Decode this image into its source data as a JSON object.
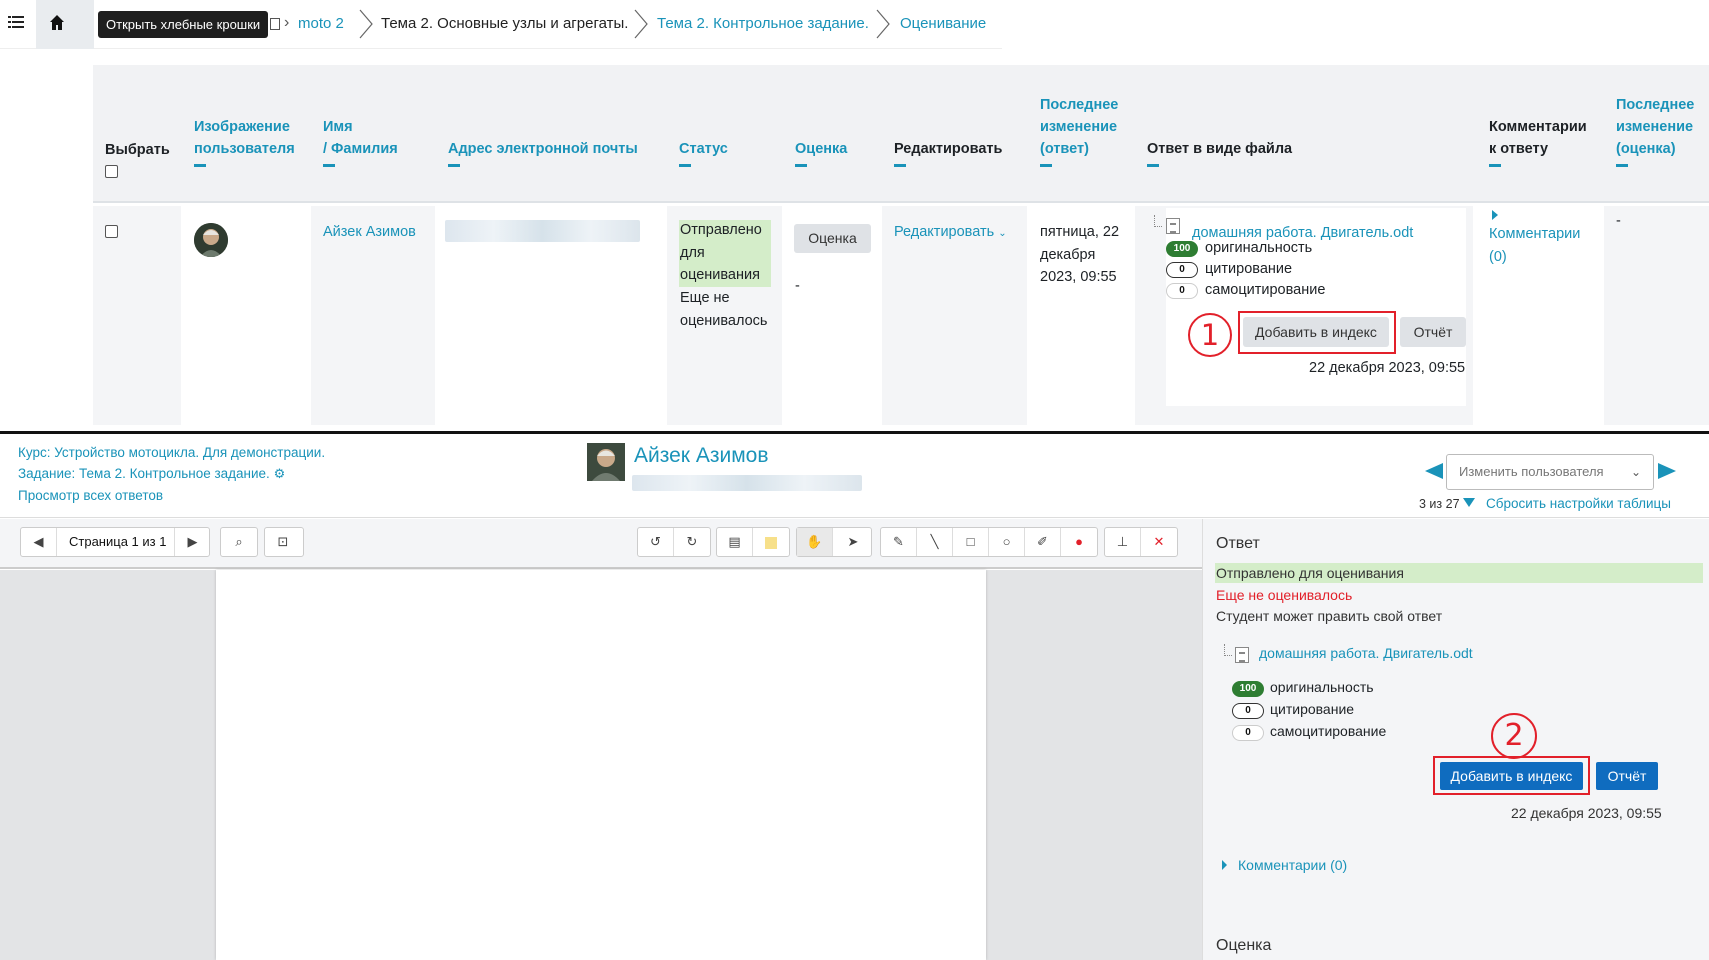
{
  "breadcrumb": {
    "tooltip": "Открыть хлебные крошки",
    "items": [
      {
        "label": "moto 2",
        "link": true
      },
      {
        "label": "Тема 2. Основные узлы и агрегаты.",
        "link": false
      },
      {
        "label": "Тема 2. Контрольное задание.",
        "link": true
      },
      {
        "label": "Оценивание",
        "link": true
      }
    ]
  },
  "table": {
    "headers": {
      "select": "Выбрать",
      "picture": [
        "Изображение",
        "пользователя"
      ],
      "name": [
        "Имя",
        "/ Фамилия"
      ],
      "email": "Адрес электронной почты",
      "status": "Статус",
      "grade": "Оценка",
      "edit": "Редактировать",
      "last_modified_submission": [
        "Последнее",
        "изменение",
        "(ответ)"
      ],
      "file_submission": "Ответ в виде файла",
      "comments": [
        "Комментарии",
        "к ответу"
      ],
      "last_modified_grade": [
        "Последнее",
        "изменение",
        "(оценка)"
      ]
    },
    "row": {
      "name": "Айзек Азимов",
      "status_submitted": [
        "Отправлено",
        "для",
        "оценивания"
      ],
      "status_graded": [
        "Еще не",
        "оценивалось"
      ],
      "grade_button": "Оценка",
      "grade_value": "-",
      "edit_link": "Редактировать",
      "last_modified": [
        "пятница, 22",
        "декабря",
        "2023, 09:55"
      ],
      "file_name": "домашняя работа. Двигатель.odt",
      "originality": {
        "score": "100",
        "label": "оригинальность"
      },
      "citation": {
        "score": "0",
        "label": "цитирование"
      },
      "selfcitation": {
        "score": "0",
        "label": "самоцитирование"
      },
      "add_index_button": "Добавить в индекс",
      "report_button": "Отчёт",
      "file_date": "22 декабря 2023, 09:55",
      "comments_link": [
        "Комментарии",
        "(0)"
      ],
      "grade_modified": "-"
    },
    "annotation_number": "1"
  },
  "grader": {
    "course_link": "Курс: Устройство мотоцикла. Для демонстрации.",
    "assignment_link": "Задание: Тема 2. Контрольное задание.",
    "view_all_link": "Просмотр всех ответов",
    "user_name": "Айзек Азимов",
    "change_user_placeholder": "Изменить пользователя",
    "counter": "3 из 27",
    "reset_table": "Сбросить настройки таблицы",
    "page_label": "Страница 1 из 1",
    "side": {
      "answer_heading": "Ответ",
      "status_submitted": "Отправлено для оценивания",
      "status_graded": "Еще не оценивалось",
      "can_edit": "Студент может править свой ответ",
      "file_name": "домашняя работа. Двигатель.odt",
      "originality": {
        "score": "100",
        "label": "оригинальность"
      },
      "citation": {
        "score": "0",
        "label": "цитирование"
      },
      "selfcitation": {
        "score": "0",
        "label": "самоцитирование"
      },
      "add_index_button": "Добавить в индекс",
      "report_button": "Отчёт",
      "file_date": "22 декабря 2023, 09:55",
      "comments_link": "Комментарии (0)",
      "grade_heading": "Оценка"
    },
    "annotation_number": "2"
  },
  "colors": {
    "accent": "#1a93b9",
    "submitted_bg": "#d4edc9",
    "not_graded": "#e2202a",
    "annotation_red": "#e2202a",
    "primary_button": "#0f6cbf"
  }
}
